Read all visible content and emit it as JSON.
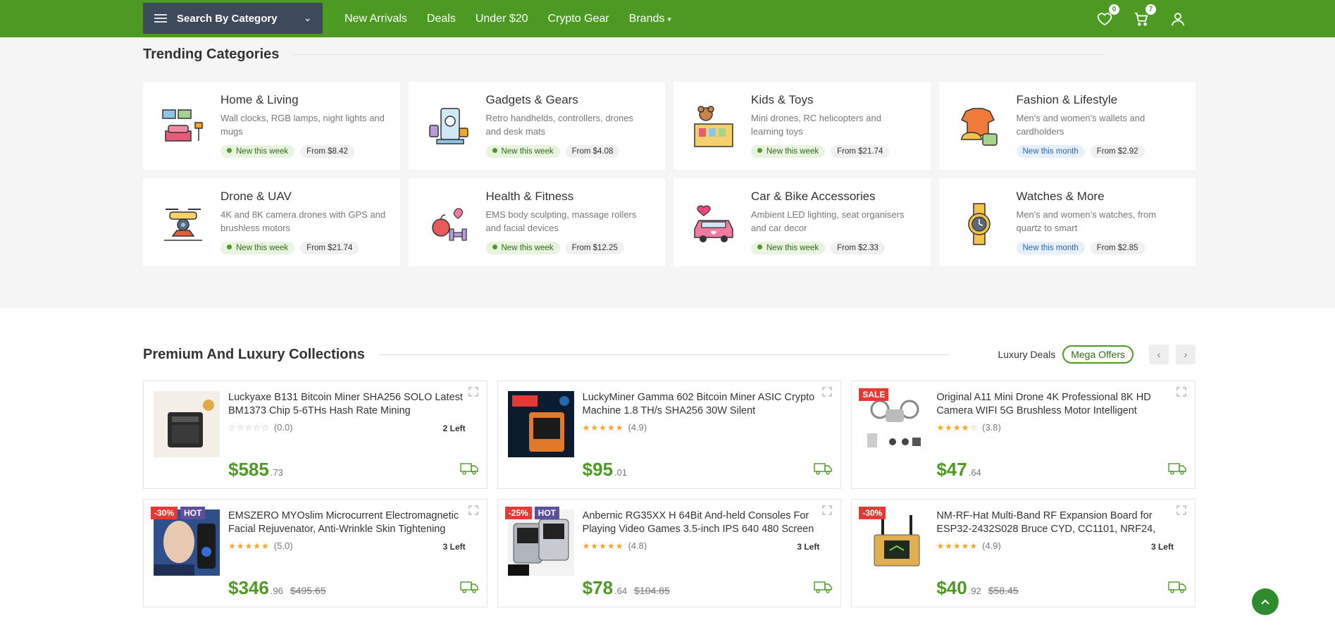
{
  "nav": {
    "category_button": "Search By Category",
    "links": [
      "New Arrivals",
      "Deals",
      "Under $20",
      "Crypto Gear",
      "Brands"
    ],
    "wishlist_count": "0",
    "cart_count": "7"
  },
  "trending": {
    "title": "Trending Categories",
    "categories": [
      {
        "name": "Home & Living",
        "desc": "Wall clocks, RGB lamps, night lights and mugs",
        "status": "New this week",
        "from": "From $8.42",
        "icon": "sofa-icon"
      },
      {
        "name": "Gadgets & Gears",
        "desc": "Retro handhelds, controllers, drones and desk mats",
        "status": "New this week",
        "from": "From $4.08",
        "icon": "devices-icon"
      },
      {
        "name": "Kids & Toys",
        "desc": "Mini drones, RC helicopters and learning toys",
        "status": "New this week",
        "from": "From $21.74",
        "icon": "toy-box-icon"
      },
      {
        "name": "Fashion & Lifestyle",
        "desc": "Men's and women's wallets and cardholders",
        "status": "New this month",
        "from": "From $2.92",
        "icon": "clothes-icon"
      },
      {
        "name": "Drone & UAV",
        "desc": "4K and 8K camera drones with GPS and brushless motors",
        "status": "New this week",
        "from": "From $21.74",
        "icon": "drone-icon"
      },
      {
        "name": "Health & Fitness",
        "desc": "EMS body sculpting, massage rollers and facial devices",
        "status": "New this week",
        "from": "From $12.25",
        "icon": "fitness-icon"
      },
      {
        "name": "Car & Bike Accessories",
        "desc": "Ambient LED lighting, seat organisers and car decor",
        "status": "New this week",
        "from": "From $2.33",
        "icon": "car-icon"
      },
      {
        "name": "Watches & More",
        "desc": "Men's and women's watches, from quartz to smart",
        "status": "New this month",
        "from": "From $2.85",
        "icon": "watch-icon"
      }
    ]
  },
  "premium": {
    "title": "Premium And Luxury Collections",
    "tab_luxury": "Luxury Deals",
    "tab_mega": "Mega Offers",
    "products": [
      {
        "title": "Luckyaxe B131 Bitcoin Miner SHA256 SOLO Latest BM1373 Chip 5-6THs Hash Rate Mining",
        "rating": "(0.0)",
        "stars": 0,
        "stock": "2 Left",
        "price": "$585",
        "cents": ".73",
        "old": "",
        "badges": []
      },
      {
        "title": "LuckyMiner Gamma 602 Bitcoin Miner ASIC Crypto Machine 1.8 TH/s SHA256 30W Silent",
        "rating": "(4.9)",
        "stars": 5,
        "stock": "",
        "price": "$95",
        "cents": ".01",
        "old": "",
        "badges": []
      },
      {
        "title": "Original A11 Mini Drone 4K Professional 8K HD Camera WIFI 5G Brushless Motor Intelligent",
        "rating": "(3.8)",
        "stars": 4,
        "stock": "",
        "price": "$47",
        "cents": ".64",
        "old": "",
        "badges": [
          "SALE"
        ]
      },
      {
        "title": "EMSZERO MYOslim Microcurrent Electromagnetic Facial Rejuvenator, Anti-Wrinkle Skin Tightening",
        "rating": "(5.0)",
        "stars": 5,
        "stock": "3 Left",
        "price": "$346",
        "cents": ".96",
        "old": "$495.65",
        "badges": [
          "-30%",
          "HOT"
        ]
      },
      {
        "title": "Anbernic RG35XX H 64Bit And-held Consoles For Playing Video Games 3.5-inch IPS 640 480 Screen",
        "rating": "(4.8)",
        "stars": 5,
        "stock": "3 Left",
        "price": "$78",
        "cents": ".64",
        "old": "$104.85",
        "badges": [
          "-25%",
          "HOT"
        ]
      },
      {
        "title": "NM-RF-Hat Multi-Band RF Expansion Board for ESP32-2432S028 Bruce CYD, CC1101, NRF24,",
        "rating": "(4.9)",
        "stars": 5,
        "stock": "3 Left",
        "price": "$40",
        "cents": ".92",
        "old": "$58.45",
        "badges": [
          "-30%"
        ]
      }
    ]
  },
  "colors": {
    "brand_green": "#4c9a22",
    "nav_dark": "#3c4a5a",
    "badge_red": "#e53935",
    "badge_purple": "#5b4f9e"
  }
}
